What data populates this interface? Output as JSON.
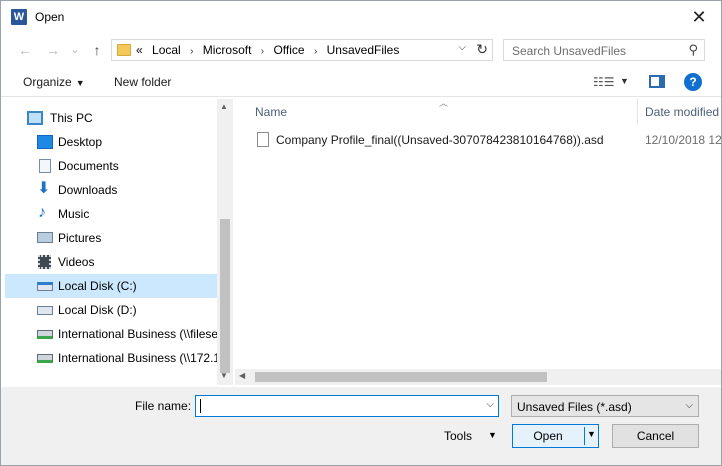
{
  "window": {
    "title": "Open",
    "app_icon": "W",
    "close_glyph": "✕"
  },
  "navbar": {
    "back_glyph": "←",
    "forward_glyph": "→",
    "recent_glyph": "⌄",
    "up_glyph": "↑",
    "overflow": "«",
    "breadcrumb": [
      "Local",
      "Microsoft",
      "Office",
      "UnsavedFiles"
    ],
    "separator": "›",
    "search_placeholder": "Search UnsavedFiles"
  },
  "toolbar": {
    "organize_label": "Organize",
    "new_folder_label": "New folder",
    "help_label": "?"
  },
  "nav_pane": {
    "items": [
      {
        "label": "This PC",
        "icon": "computer-icon"
      },
      {
        "label": "Desktop",
        "icon": "desktop-icon"
      },
      {
        "label": "Documents",
        "icon": "documents-icon"
      },
      {
        "label": "Downloads",
        "icon": "downloads-icon"
      },
      {
        "label": "Music",
        "icon": "music-icon"
      },
      {
        "label": "Pictures",
        "icon": "pictures-icon"
      },
      {
        "label": "Videos",
        "icon": "videos-icon"
      },
      {
        "label": "Local Disk (C:)",
        "icon": "drive-icon",
        "selected": true
      },
      {
        "label": "Local Disk (D:)",
        "icon": "drive-icon"
      },
      {
        "label": "International Business (\\\\filese",
        "icon": "network-drive-icon"
      },
      {
        "label": "International Business (\\\\172.1",
        "icon": "network-drive-icon"
      }
    ]
  },
  "file_list": {
    "columns": {
      "name": "Name",
      "date_modified": "Date modified"
    },
    "files": [
      {
        "name": "Company Profile_final((Unsaved-307078423810164768)).asd",
        "date_modified": "12/10/2018 12"
      }
    ]
  },
  "bottom": {
    "file_name_label": "File name:",
    "file_name_value": "",
    "file_type_value": "Unsaved Files (*.asd)",
    "tools_label": "Tools",
    "open_label": "Open",
    "cancel_label": "Cancel"
  },
  "colors": {
    "accent": "#0078d7",
    "selection": "#cce8ff",
    "bottom_bg": "#f0f0f0"
  }
}
